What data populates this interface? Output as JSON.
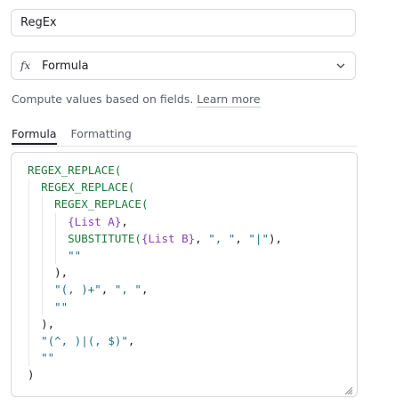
{
  "field_name": "RegEx",
  "field_type": {
    "label": "Formula",
    "icon": "fx-icon"
  },
  "description": {
    "text": "Compute values based on fields.",
    "link": "Learn more"
  },
  "tabs": [
    {
      "label": "Formula",
      "active": true
    },
    {
      "label": "Formatting",
      "active": false
    }
  ],
  "code_lines": [
    {
      "indent": 0,
      "tokens": [
        {
          "t": "fn",
          "v": "REGEX_REPLACE("
        }
      ]
    },
    {
      "indent": 1,
      "tokens": [
        {
          "t": "fn",
          "v": "REGEX_REPLACE("
        }
      ]
    },
    {
      "indent": 2,
      "tokens": [
        {
          "t": "fn",
          "v": "REGEX_REPLACE("
        }
      ]
    },
    {
      "indent": 3,
      "tokens": [
        {
          "t": "field",
          "v": "{List A}"
        },
        {
          "t": "punc",
          "v": ","
        }
      ]
    },
    {
      "indent": 3,
      "tokens": [
        {
          "t": "fn",
          "v": "SUBSTITUTE("
        },
        {
          "t": "field",
          "v": "{List B}"
        },
        {
          "t": "punc",
          "v": ", "
        },
        {
          "t": "str",
          "v": "\", \""
        },
        {
          "t": "punc",
          "v": ", "
        },
        {
          "t": "str",
          "v": "\"|\""
        },
        {
          "t": "punc",
          "v": "),"
        }
      ]
    },
    {
      "indent": 3,
      "tokens": [
        {
          "t": "str",
          "v": "\"\""
        }
      ]
    },
    {
      "indent": 2,
      "tokens": [
        {
          "t": "punc",
          "v": "),"
        }
      ]
    },
    {
      "indent": 2,
      "tokens": [
        {
          "t": "str",
          "v": "\"(, )+\""
        },
        {
          "t": "punc",
          "v": ", "
        },
        {
          "t": "str",
          "v": "\", \""
        },
        {
          "t": "punc",
          "v": ","
        }
      ]
    },
    {
      "indent": 2,
      "tokens": [
        {
          "t": "str",
          "v": "\"\""
        }
      ]
    },
    {
      "indent": 1,
      "tokens": [
        {
          "t": "punc",
          "v": "),"
        }
      ]
    },
    {
      "indent": 1,
      "tokens": [
        {
          "t": "str",
          "v": "\"(^, )|(, $)\""
        },
        {
          "t": "punc",
          "v": ","
        }
      ]
    },
    {
      "indent": 1,
      "tokens": [
        {
          "t": "str",
          "v": "\"\""
        }
      ]
    },
    {
      "indent": 0,
      "tokens": [
        {
          "t": "punc",
          "v": ")"
        }
      ]
    }
  ],
  "colors": {
    "function": "#1d7a3a",
    "field_ref": "#8a3fb8",
    "string": "#1f6f8b",
    "border": "#d5d8de"
  }
}
